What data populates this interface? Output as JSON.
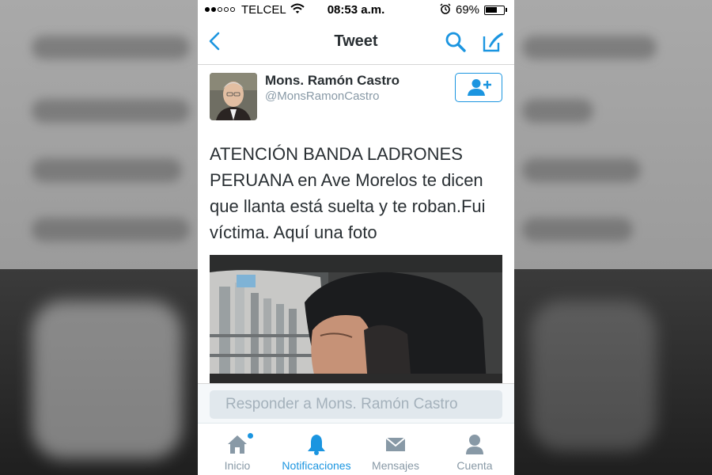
{
  "status_bar": {
    "carrier": "TELCEL",
    "time": "08:53 a.m.",
    "battery_percent_text": "69%",
    "battery_level": 0.69
  },
  "nav": {
    "title": "Tweet",
    "back_icon": "chevron-left-icon",
    "search_icon": "search-icon",
    "compose_icon": "compose-icon"
  },
  "tweet": {
    "author_name": "Mons. Ramón Castro",
    "author_handle": "@MonsRamonCastro",
    "follow_icon": "add-user-icon",
    "text": "ATENCIÓN BANDA LADRONES PERUANA en Ave Morelos te dicen que llanta está suelta y te roban.Fui víctima. Aquí una foto"
  },
  "reply": {
    "placeholder": "Responder a Mons. Ramón Castro"
  },
  "tabs": [
    {
      "label": "Inicio",
      "icon": "home-icon"
    },
    {
      "label": "Notificaciones",
      "icon": "bell-icon"
    },
    {
      "label": "Mensajes",
      "icon": "envelope-icon"
    },
    {
      "label": "Cuenta",
      "icon": "person-icon"
    }
  ],
  "colors": {
    "accent": "#1b95e0",
    "text": "#292f33",
    "muted": "#8899a6"
  }
}
